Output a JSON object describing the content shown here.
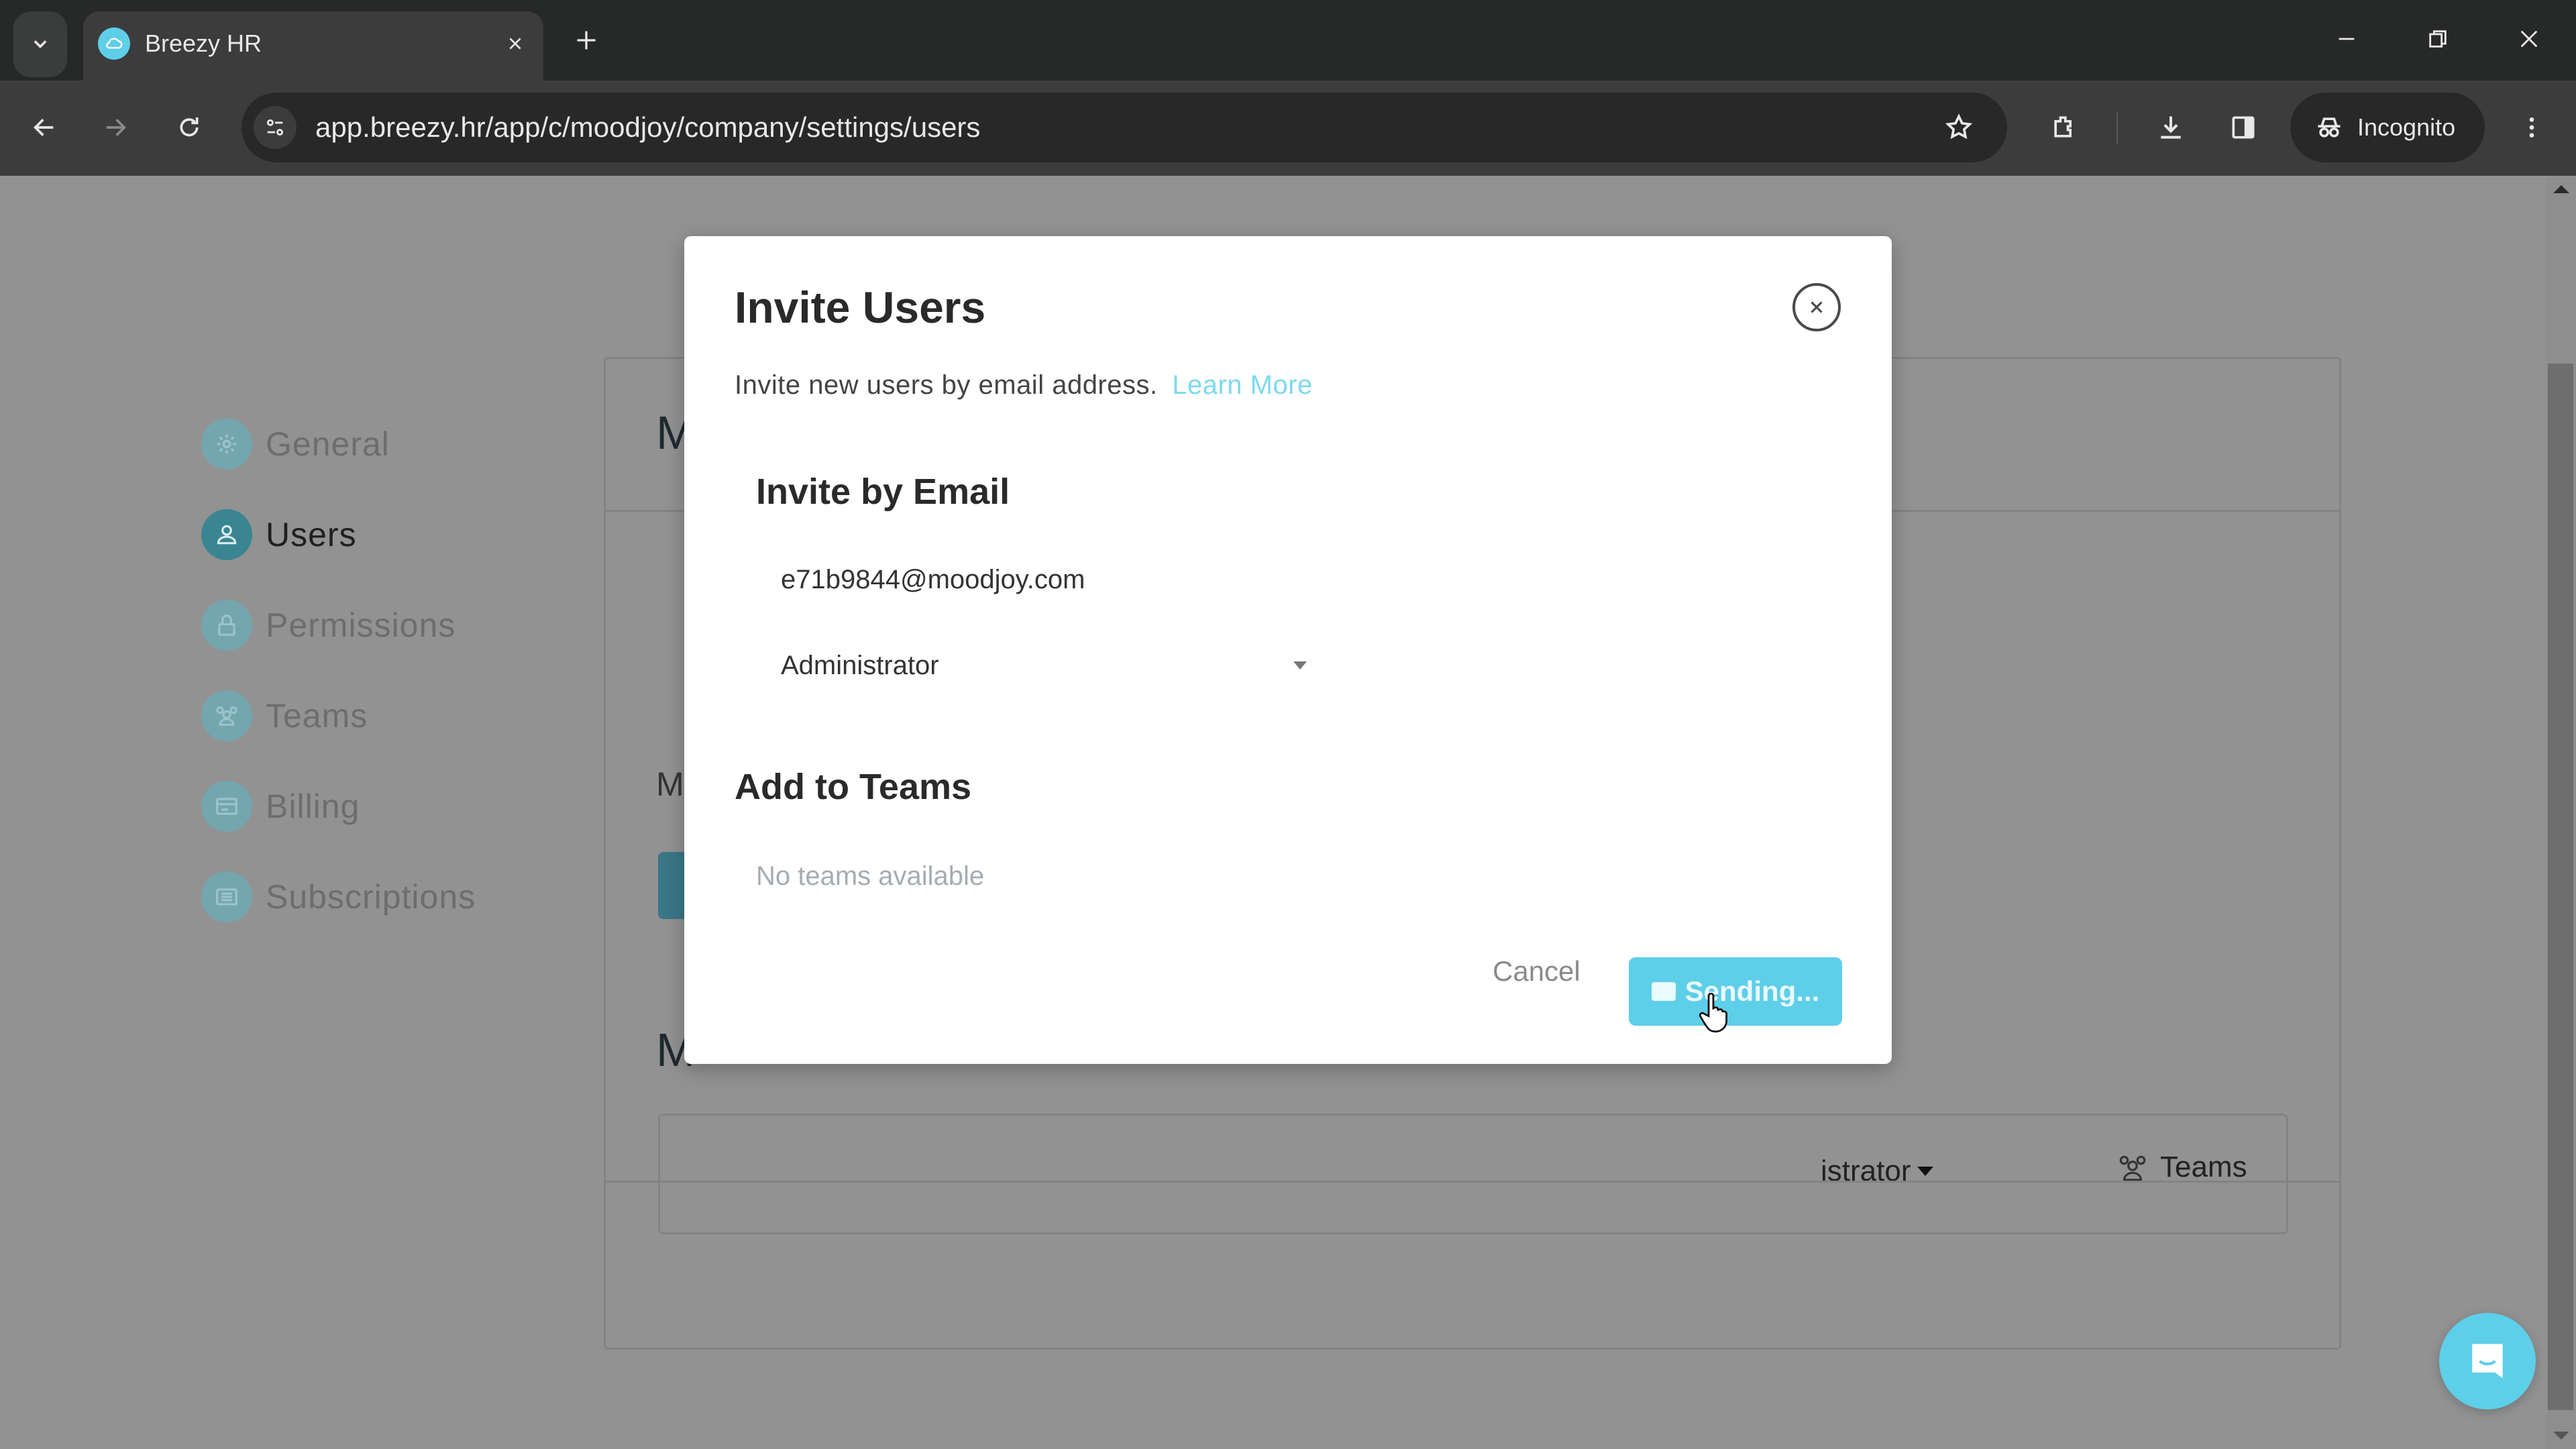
{
  "browser": {
    "tab_title": "Breezy HR",
    "url": "app.breezy.hr/app/c/moodjoy/company/settings/users",
    "incognito_label": "Incognito",
    "icons": [
      "tab-search-icon",
      "favicon-breezy-icon",
      "tab-close-icon",
      "new-tab-icon",
      "minimize-icon",
      "restore-icon",
      "window-close-icon",
      "back-icon",
      "forward-icon",
      "reload-icon",
      "site-info-icon",
      "bookmark-star-icon",
      "extensions-icon",
      "download-icon",
      "side-panel-icon",
      "incognito-icon",
      "menu-kebab-icon"
    ]
  },
  "sidebar": {
    "items": [
      {
        "label": "General",
        "icon": "gear-icon",
        "active": false
      },
      {
        "label": "Users",
        "icon": "user-icon",
        "active": true
      },
      {
        "label": "Permissions",
        "icon": "lock-icon",
        "active": false
      },
      {
        "label": "Teams",
        "icon": "team-icon",
        "active": false
      },
      {
        "label": "Billing",
        "icon": "billing-icon",
        "active": false
      },
      {
        "label": "Subscriptions",
        "icon": "subscriptions-icon",
        "active": false
      }
    ]
  },
  "background": {
    "heading_partial": "M",
    "subheading_partial": "M",
    "section_partial": "M",
    "member_role_partial": "istrator",
    "member_teams_label": "Teams"
  },
  "modal": {
    "title": "Invite Users",
    "description": "Invite new users by email address.",
    "learn_more": "Learn More",
    "invite_section_title": "Invite by Email",
    "email_value": "e71b9844@moodjoy.com",
    "role_selected": "Administrator",
    "teams_section_title": "Add to Teams",
    "no_teams_text": "No teams available",
    "cancel_label": "Cancel",
    "send_label": "Sending...",
    "accent_color": "#5ecfe9"
  }
}
